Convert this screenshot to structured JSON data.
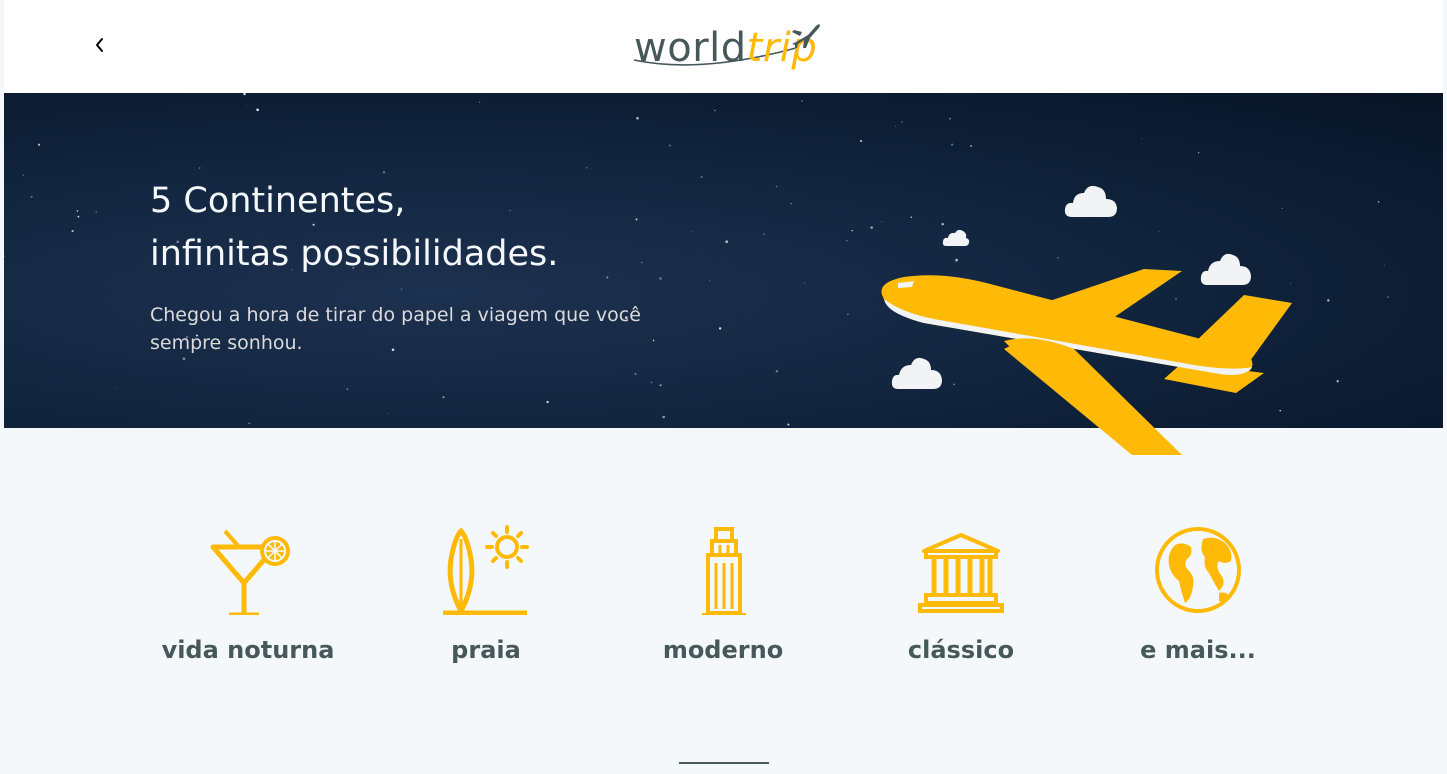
{
  "header": {
    "back_icon": "chevron-left-icon",
    "logo": {
      "world": "world",
      "trip": "trip",
      "icon": "airplane-icon"
    }
  },
  "banner": {
    "title_line1": "5 Continentes,",
    "title_line2": "infinitas possibilidades.",
    "subtitle": "Chegou a hora de tirar do papel a viagem que você sempre sonhou.",
    "illustration": "airplane-with-clouds",
    "colors": {
      "background": "#0b1a2f",
      "airplane": "#ffba08"
    }
  },
  "travel_types": [
    {
      "label": "vida noturna",
      "icon": "cocktail-icon"
    },
    {
      "label": "praia",
      "icon": "surfboard-sun-icon"
    },
    {
      "label": "moderno",
      "icon": "skyscraper-icon"
    },
    {
      "label": "clássico",
      "icon": "museum-icon"
    },
    {
      "label": "e mais...",
      "icon": "globe-icon"
    }
  ],
  "colors": {
    "accent": "#ffba08",
    "text_dark": "#47585b",
    "light_bg": "#f5f8fa"
  }
}
